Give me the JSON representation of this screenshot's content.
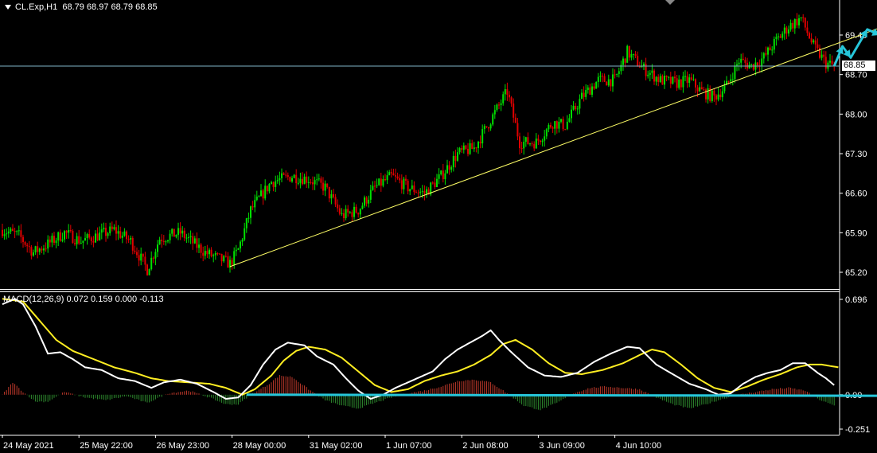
{
  "header": {
    "symbol": "CL.Exp,H1",
    "ohlc": "68.79 68.97 68.79 68.85"
  },
  "current_price_label": "68.85",
  "macd_header": "MACD(12,26,9) 0.072 0.159 0.000 -0.113",
  "colors": {
    "bull": "#00e000",
    "bear": "#e00000",
    "trendline": "#ffff66",
    "price_line": "#7fb3c8",
    "arrow": "#26c6da",
    "macd_line": "#ffffff",
    "signal_line": "#ffee22",
    "grid_border": "#ffffff"
  },
  "chart_data": [
    {
      "type": "candlestick",
      "symbol": "CL.Exp",
      "timeframe": "H1",
      "ylim": [
        64.9,
        70.1
      ],
      "yticks": [
        "69.40",
        "68.70",
        "68.00",
        "67.30",
        "66.60",
        "65.90",
        "65.20"
      ],
      "xticks": [
        "24 May 2021",
        "25 May 22:00",
        "26 May 23:00",
        "28 May 00:00",
        "31 May 02:00",
        "1 Jun 07:00",
        "2 Jun 08:00",
        "3 Jun 09:00",
        "4 Jun 10:00"
      ],
      "current_price": 68.85,
      "close_anchors": [
        [
          0,
          65.95
        ],
        [
          8,
          65.85
        ],
        [
          15,
          65.55
        ],
        [
          22,
          65.7
        ],
        [
          30,
          65.9
        ],
        [
          38,
          65.75
        ],
        [
          46,
          65.85
        ],
        [
          54,
          65.95
        ],
        [
          62,
          65.75
        ],
        [
          70,
          65.25
        ],
        [
          76,
          65.8
        ],
        [
          86,
          65.9
        ],
        [
          98,
          65.55
        ],
        [
          110,
          65.35
        ],
        [
          114,
          65.6
        ],
        [
          120,
          66.3
        ],
        [
          130,
          66.8
        ],
        [
          140,
          66.9
        ],
        [
          148,
          66.85
        ],
        [
          156,
          66.7
        ],
        [
          164,
          66.2
        ],
        [
          172,
          66.3
        ],
        [
          180,
          66.7
        ],
        [
          188,
          66.9
        ],
        [
          196,
          66.7
        ],
        [
          204,
          66.6
        ],
        [
          212,
          66.9
        ],
        [
          220,
          67.3
        ],
        [
          228,
          67.4
        ],
        [
          236,
          67.9
        ],
        [
          244,
          68.4
        ],
        [
          250,
          67.5
        ],
        [
          258,
          67.5
        ],
        [
          266,
          67.85
        ],
        [
          272,
          67.8
        ],
        [
          280,
          68.3
        ],
        [
          288,
          68.6
        ],
        [
          296,
          68.6
        ],
        [
          302,
          69.1
        ],
        [
          310,
          68.8
        ],
        [
          318,
          68.6
        ],
        [
          326,
          68.55
        ],
        [
          332,
          68.6
        ],
        [
          338,
          68.4
        ],
        [
          344,
          68.3
        ],
        [
          350,
          68.5
        ],
        [
          356,
          68.95
        ],
        [
          362,
          68.85
        ],
        [
          368,
          69.0
        ],
        [
          374,
          69.3
        ],
        [
          380,
          69.55
        ],
        [
          386,
          69.7
        ],
        [
          392,
          69.2
        ],
        [
          398,
          68.9
        ],
        [
          402,
          68.85
        ]
      ],
      "trendline": {
        "from": [
          110,
          65.3
        ],
        "to": [
          500,
          70.55
        ],
        "color": "yellow"
      },
      "projection_arrows": [
        [
          402,
          68.85
        ],
        [
          406,
          69.2
        ],
        [
          410,
          69.0
        ],
        [
          418,
          69.5
        ],
        [
          424,
          69.4
        ],
        [
          432,
          70.05
        ]
      ]
    },
    {
      "type": "macd",
      "params": [
        12,
        26,
        9
      ],
      "values": {
        "macd": 0.072,
        "signal": 0.159,
        "hist": 0.0,
        "diff": -0.113
      },
      "ylim": [
        -0.27,
        0.72
      ],
      "yticks": [
        "0.696",
        "0.00",
        "-0.251"
      ],
      "macd_anchors": [
        [
          0,
          0.66
        ],
        [
          6,
          0.7
        ],
        [
          10,
          0.66
        ],
        [
          16,
          0.5
        ],
        [
          22,
          0.3
        ],
        [
          28,
          0.31
        ],
        [
          34,
          0.26
        ],
        [
          40,
          0.2
        ],
        [
          48,
          0.18
        ],
        [
          56,
          0.12
        ],
        [
          64,
          0.1
        ],
        [
          72,
          0.05
        ],
        [
          78,
          0.09
        ],
        [
          86,
          0.11
        ],
        [
          94,
          0.08
        ],
        [
          102,
          0.02
        ],
        [
          108,
          -0.03
        ],
        [
          114,
          -0.02
        ],
        [
          120,
          0.07
        ],
        [
          126,
          0.22
        ],
        [
          132,
          0.33
        ],
        [
          138,
          0.38
        ],
        [
          146,
          0.36
        ],
        [
          152,
          0.28
        ],
        [
          160,
          0.22
        ],
        [
          166,
          0.12
        ],
        [
          172,
          0.03
        ],
        [
          178,
          -0.03
        ],
        [
          184,
          0.0
        ],
        [
          190,
          0.05
        ],
        [
          196,
          0.09
        ],
        [
          202,
          0.13
        ],
        [
          208,
          0.17
        ],
        [
          214,
          0.26
        ],
        [
          220,
          0.33
        ],
        [
          226,
          0.38
        ],
        [
          232,
          0.43
        ],
        [
          236,
          0.47
        ],
        [
          240,
          0.4
        ],
        [
          246,
          0.31
        ],
        [
          254,
          0.2
        ],
        [
          262,
          0.14
        ],
        [
          270,
          0.13
        ],
        [
          278,
          0.16
        ],
        [
          286,
          0.24
        ],
        [
          294,
          0.3
        ],
        [
          302,
          0.35
        ],
        [
          308,
          0.34
        ],
        [
          316,
          0.22
        ],
        [
          324,
          0.15
        ],
        [
          332,
          0.08
        ],
        [
          340,
          0.04
        ],
        [
          346,
          0.0
        ],
        [
          352,
          0.01
        ],
        [
          358,
          0.08
        ],
        [
          364,
          0.13
        ],
        [
          370,
          0.16
        ],
        [
          376,
          0.18
        ],
        [
          382,
          0.23
        ],
        [
          388,
          0.23
        ],
        [
          394,
          0.16
        ],
        [
          398,
          0.12
        ],
        [
          402,
          0.07
        ]
      ],
      "signal_anchors": [
        [
          0,
          0.7
        ],
        [
          10,
          0.68
        ],
        [
          18,
          0.54
        ],
        [
          26,
          0.4
        ],
        [
          34,
          0.32
        ],
        [
          44,
          0.26
        ],
        [
          54,
          0.2
        ],
        [
          64,
          0.16
        ],
        [
          72,
          0.12
        ],
        [
          80,
          0.1
        ],
        [
          90,
          0.09
        ],
        [
          100,
          0.08
        ],
        [
          108,
          0.05
        ],
        [
          116,
          0.0
        ],
        [
          122,
          0.04
        ],
        [
          130,
          0.14
        ],
        [
          136,
          0.25
        ],
        [
          142,
          0.32
        ],
        [
          148,
          0.35
        ],
        [
          156,
          0.33
        ],
        [
          164,
          0.27
        ],
        [
          172,
          0.17
        ],
        [
          180,
          0.07
        ],
        [
          188,
          0.02
        ],
        [
          196,
          0.04
        ],
        [
          204,
          0.1
        ],
        [
          212,
          0.14
        ],
        [
          220,
          0.17
        ],
        [
          228,
          0.22
        ],
        [
          236,
          0.29
        ],
        [
          242,
          0.37
        ],
        [
          248,
          0.4
        ],
        [
          256,
          0.33
        ],
        [
          264,
          0.23
        ],
        [
          272,
          0.16
        ],
        [
          280,
          0.15
        ],
        [
          290,
          0.18
        ],
        [
          300,
          0.23
        ],
        [
          308,
          0.29
        ],
        [
          314,
          0.33
        ],
        [
          320,
          0.31
        ],
        [
          328,
          0.22
        ],
        [
          336,
          0.12
        ],
        [
          344,
          0.05
        ],
        [
          352,
          0.02
        ],
        [
          360,
          0.06
        ],
        [
          368,
          0.11
        ],
        [
          376,
          0.15
        ],
        [
          384,
          0.2
        ],
        [
          390,
          0.22
        ],
        [
          396,
          0.22
        ],
        [
          404,
          0.2
        ]
      ],
      "hist_anchors": [
        [
          0,
          0.0
        ],
        [
          5,
          0.09
        ],
        [
          10,
          0.02
        ],
        [
          16,
          -0.05
        ],
        [
          22,
          -0.05
        ],
        [
          30,
          0.02
        ],
        [
          40,
          -0.02
        ],
        [
          50,
          -0.04
        ],
        [
          60,
          -0.01
        ],
        [
          70,
          -0.06
        ],
        [
          80,
          0.01
        ],
        [
          90,
          0.03
        ],
        [
          100,
          -0.02
        ],
        [
          108,
          -0.07
        ],
        [
          114,
          -0.07
        ],
        [
          120,
          0.0
        ],
        [
          128,
          0.07
        ],
        [
          134,
          0.14
        ],
        [
          140,
          0.13
        ],
        [
          148,
          0.04
        ],
        [
          156,
          -0.04
        ],
        [
          164,
          -0.08
        ],
        [
          172,
          -0.1
        ],
        [
          180,
          -0.06
        ],
        [
          188,
          -0.02
        ],
        [
          196,
          0.01
        ],
        [
          204,
          0.03
        ],
        [
          212,
          0.06
        ],
        [
          220,
          0.1
        ],
        [
          228,
          0.11
        ],
        [
          236,
          0.09
        ],
        [
          244,
          0.01
        ],
        [
          252,
          -0.08
        ],
        [
          260,
          -0.11
        ],
        [
          268,
          -0.06
        ],
        [
          276,
          0.01
        ],
        [
          284,
          0.05
        ],
        [
          292,
          0.06
        ],
        [
          300,
          0.05
        ],
        [
          308,
          0.04
        ],
        [
          316,
          -0.02
        ],
        [
          324,
          -0.07
        ],
        [
          332,
          -0.1
        ],
        [
          340,
          -0.07
        ],
        [
          348,
          -0.03
        ],
        [
          356,
          0.0
        ],
        [
          364,
          0.02
        ],
        [
          372,
          0.04
        ],
        [
          380,
          0.05
        ],
        [
          388,
          0.03
        ],
        [
          394,
          -0.03
        ],
        [
          402,
          -0.08
        ]
      ],
      "zero_arrow": {
        "from": [
          118,
          0.0
        ],
        "to": [
          500,
          -0.01
        ],
        "color": "cyan"
      }
    }
  ]
}
